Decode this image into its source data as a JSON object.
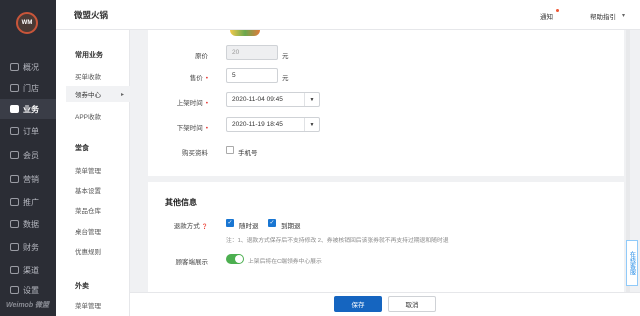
{
  "header": {
    "store_name": "微盟火锅",
    "notify_label": "通知",
    "help_label": "帮助指引"
  },
  "sidebar": {
    "logo_text": "WM",
    "items": [
      {
        "label": "概况"
      },
      {
        "label": "门店"
      },
      {
        "label": "业务",
        "active": true
      },
      {
        "label": "订单"
      },
      {
        "label": "会员"
      },
      {
        "label": "营销"
      },
      {
        "label": "推广"
      },
      {
        "label": "数据"
      },
      {
        "label": "财务"
      },
      {
        "label": "渠道"
      },
      {
        "label": "设置"
      }
    ],
    "brand": "Weimob 微盟"
  },
  "submenu": {
    "groups": [
      {
        "title": "常用业务",
        "items": [
          "买单收款",
          "领券中心",
          "APP收款"
        ]
      },
      {
        "title": "堂食",
        "items": [
          "菜单管理",
          "基本设置",
          "菜品仓库",
          "桌台管理",
          "优惠规则"
        ]
      },
      {
        "title": "外卖",
        "items": [
          "菜单管理"
        ]
      }
    ]
  },
  "form": {
    "original_price": {
      "label": "原价",
      "value": "20",
      "unit": "元"
    },
    "sale_price": {
      "label": "售价",
      "value": "5",
      "unit": "元"
    },
    "start_time": {
      "label": "上架时间",
      "value": "2020-11-04 09:45"
    },
    "end_time": {
      "label": "下架时间",
      "value": "2020-11-19 18:45"
    },
    "buy_info": {
      "label": "购买资料",
      "option": "手机号"
    }
  },
  "other": {
    "title": "其他信息",
    "refund": {
      "label": "退款方式",
      "opt1": "随时退",
      "opt2": "到期退",
      "note": "注：1、退款方式保存后不支持修改 2、券被核销回后该张券就不再支持过期退和随时退"
    },
    "display": {
      "label": "顾客端展示",
      "text": "上架后将在C端领券中心展示"
    }
  },
  "footer": {
    "save": "保存",
    "cancel": "取消"
  },
  "service_tab": "在线客服"
}
